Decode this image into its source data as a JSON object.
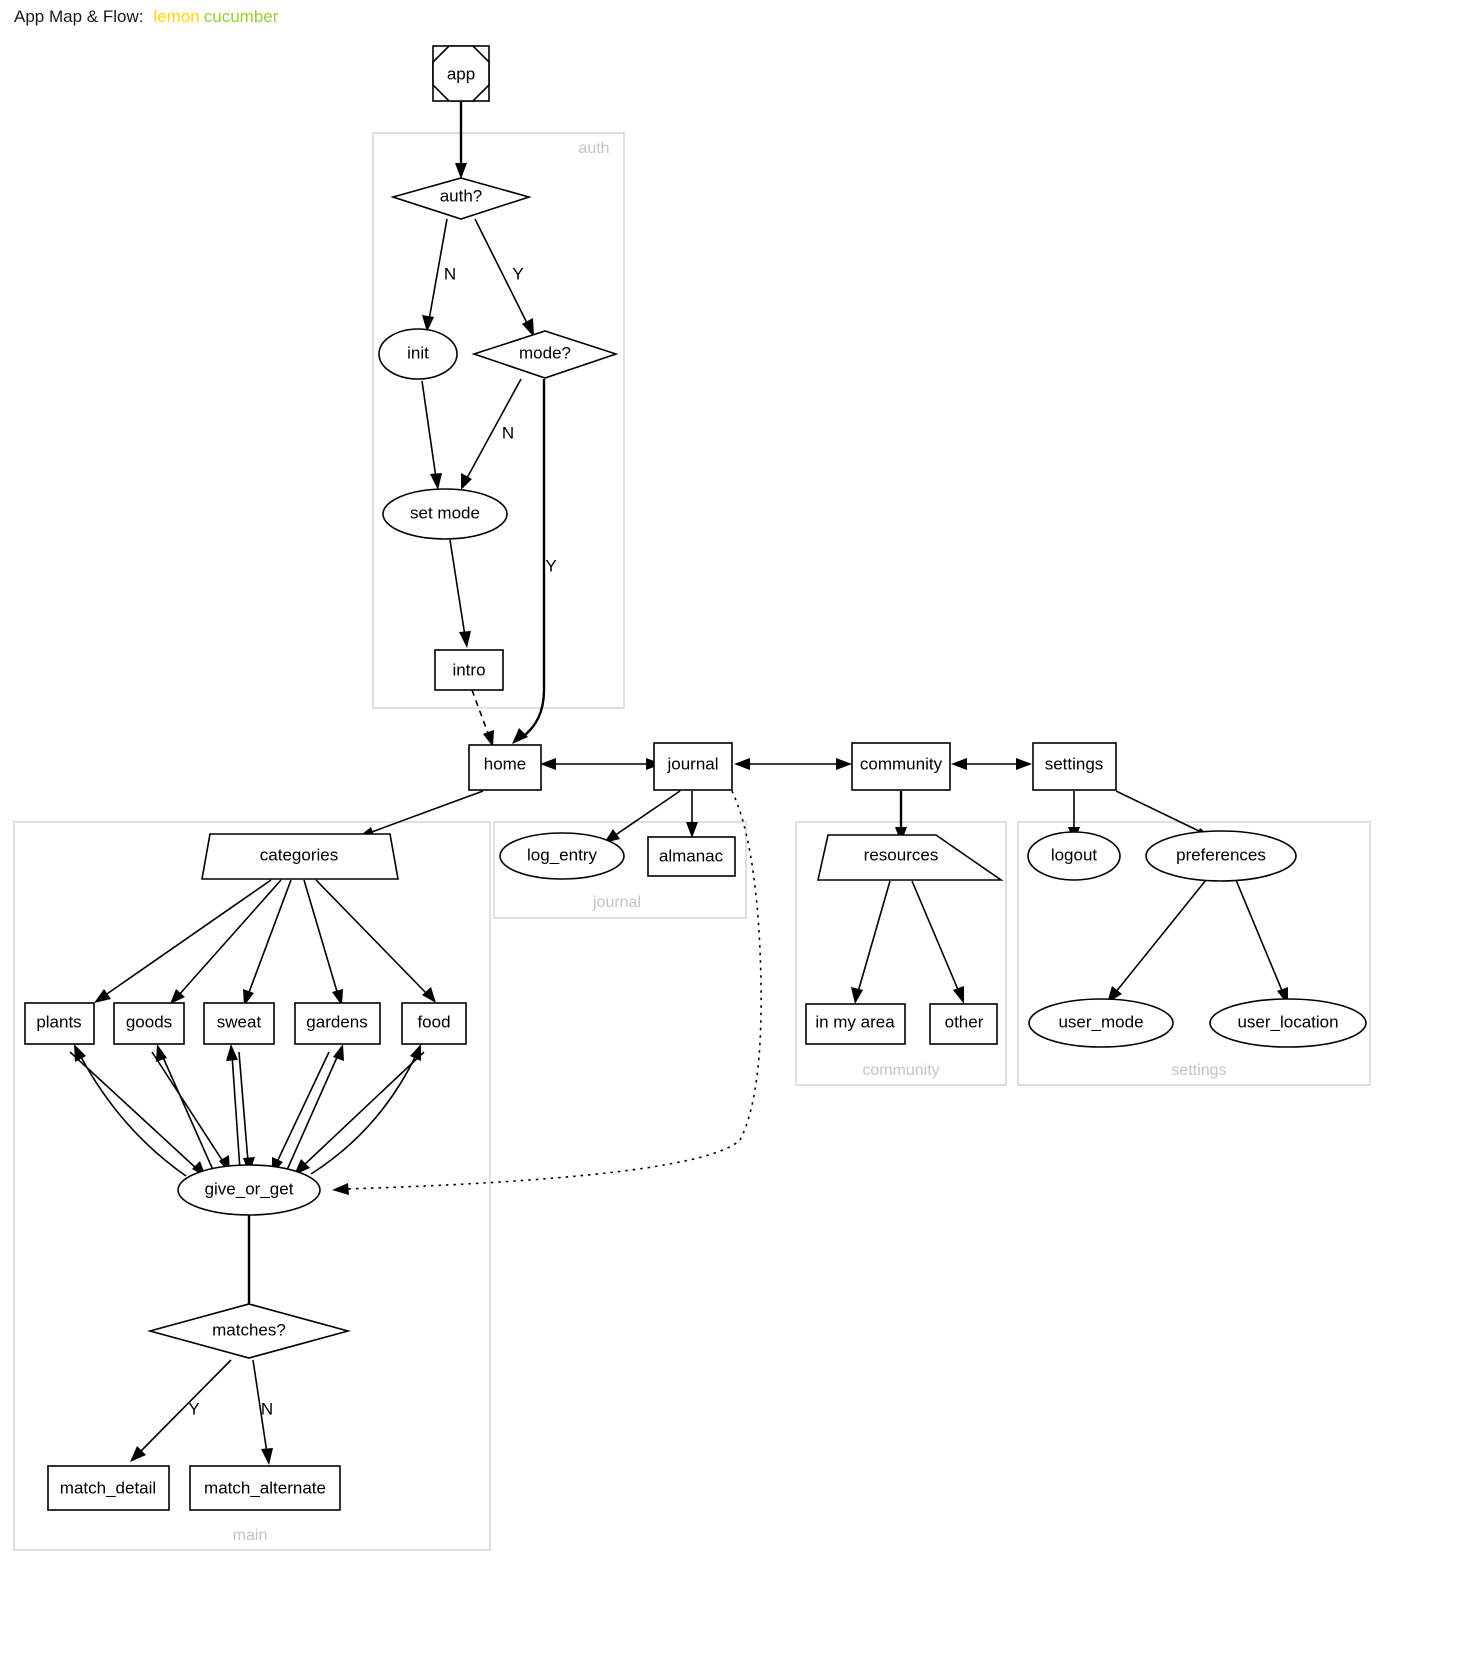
{
  "title": {
    "prefix": "App Map & Flow:",
    "word1": "lemon",
    "word2": "cucumber",
    "word1_color": "#ffd700",
    "word2_color": "#9acd32"
  },
  "clusters": [
    {
      "id": "auth",
      "label": "auth",
      "label_pos": "top-right"
    },
    {
      "id": "main",
      "label": "main",
      "label_pos": "bottom"
    },
    {
      "id": "journal",
      "label": "journal",
      "label_pos": "bottom"
    },
    {
      "id": "community",
      "label": "community",
      "label_pos": "bottom"
    },
    {
      "id": "settings",
      "label": "settings",
      "label_pos": "bottom"
    }
  ],
  "nodes": [
    {
      "id": "app",
      "label": "app",
      "shape": "doubleoctagon",
      "cluster": null
    },
    {
      "id": "auth_q",
      "label": "auth?",
      "shape": "diamond",
      "cluster": "auth"
    },
    {
      "id": "init",
      "label": "init",
      "shape": "ellipse",
      "cluster": "auth"
    },
    {
      "id": "mode_q",
      "label": "mode?",
      "shape": "diamond",
      "cluster": "auth"
    },
    {
      "id": "set_mode",
      "label": "set mode",
      "shape": "ellipse",
      "cluster": "auth"
    },
    {
      "id": "intro",
      "label": "intro",
      "shape": "box",
      "cluster": "auth"
    },
    {
      "id": "home",
      "label": "home",
      "shape": "box",
      "cluster": null
    },
    {
      "id": "journal",
      "label": "journal",
      "shape": "box",
      "cluster": null
    },
    {
      "id": "community",
      "label": "community",
      "shape": "box",
      "cluster": null
    },
    {
      "id": "settings",
      "label": "settings",
      "shape": "box",
      "cluster": null
    },
    {
      "id": "categories",
      "label": "categories",
      "shape": "invtrapezium",
      "cluster": "main"
    },
    {
      "id": "plants",
      "label": "plants",
      "shape": "box",
      "cluster": "main"
    },
    {
      "id": "goods",
      "label": "goods",
      "shape": "box",
      "cluster": "main"
    },
    {
      "id": "sweat",
      "label": "sweat",
      "shape": "box",
      "cluster": "main"
    },
    {
      "id": "gardens",
      "label": "gardens",
      "shape": "box",
      "cluster": "main"
    },
    {
      "id": "food",
      "label": "food",
      "shape": "box",
      "cluster": "main"
    },
    {
      "id": "give_or_get",
      "label": "give_or_get",
      "shape": "ellipse",
      "cluster": "main"
    },
    {
      "id": "matches_q",
      "label": "matches?",
      "shape": "diamond",
      "cluster": "main"
    },
    {
      "id": "match_detail",
      "label": "match_detail",
      "shape": "box",
      "cluster": "main"
    },
    {
      "id": "match_alternate",
      "label": "match_alternate",
      "shape": "box",
      "cluster": "main"
    },
    {
      "id": "log_entry",
      "label": "log_entry",
      "shape": "ellipse",
      "cluster": "journal"
    },
    {
      "id": "almanac",
      "label": "almanac",
      "shape": "box",
      "cluster": "journal"
    },
    {
      "id": "resources",
      "label": "resources",
      "shape": "invtrapezium",
      "cluster": "community"
    },
    {
      "id": "in_my_area",
      "label": "in my area",
      "shape": "box",
      "cluster": "community"
    },
    {
      "id": "other",
      "label": "other",
      "shape": "box",
      "cluster": "community"
    },
    {
      "id": "logout",
      "label": "logout",
      "shape": "ellipse",
      "cluster": "settings"
    },
    {
      "id": "preferences",
      "label": "preferences",
      "shape": "ellipse",
      "cluster": "settings"
    },
    {
      "id": "user_mode",
      "label": "user_mode",
      "shape": "ellipse",
      "cluster": "settings"
    },
    {
      "id": "user_location",
      "label": "user_location",
      "shape": "ellipse",
      "cluster": "settings"
    }
  ],
  "edges": [
    {
      "from": "app",
      "to": "auth_q",
      "label": "",
      "style": "solid"
    },
    {
      "from": "auth_q",
      "to": "init",
      "label": "N",
      "style": "solid"
    },
    {
      "from": "auth_q",
      "to": "mode_q",
      "label": "Y",
      "style": "solid"
    },
    {
      "from": "init",
      "to": "set_mode",
      "label": "",
      "style": "solid"
    },
    {
      "from": "mode_q",
      "to": "set_mode",
      "label": "N",
      "style": "solid"
    },
    {
      "from": "mode_q",
      "to": "home",
      "label": "Y",
      "style": "solid"
    },
    {
      "from": "set_mode",
      "to": "intro",
      "label": "",
      "style": "solid"
    },
    {
      "from": "intro",
      "to": "home",
      "label": "",
      "style": "dashed"
    },
    {
      "from": "home",
      "to": "journal",
      "label": "",
      "style": "bidirectional"
    },
    {
      "from": "journal",
      "to": "community",
      "label": "",
      "style": "bidirectional"
    },
    {
      "from": "community",
      "to": "settings",
      "label": "",
      "style": "bidirectional"
    },
    {
      "from": "home",
      "to": "categories",
      "label": "",
      "style": "solid"
    },
    {
      "from": "categories",
      "to": "plants",
      "label": "",
      "style": "solid"
    },
    {
      "from": "categories",
      "to": "goods",
      "label": "",
      "style": "solid"
    },
    {
      "from": "categories",
      "to": "sweat",
      "label": "",
      "style": "solid"
    },
    {
      "from": "categories",
      "to": "gardens",
      "label": "",
      "style": "solid"
    },
    {
      "from": "categories",
      "to": "food",
      "label": "",
      "style": "solid"
    },
    {
      "from": "plants",
      "to": "give_or_get",
      "label": "",
      "style": "solid"
    },
    {
      "from": "goods",
      "to": "give_or_get",
      "label": "",
      "style": "solid"
    },
    {
      "from": "sweat",
      "to": "give_or_get",
      "label": "",
      "style": "solid"
    },
    {
      "from": "gardens",
      "to": "give_or_get",
      "label": "",
      "style": "solid"
    },
    {
      "from": "food",
      "to": "give_or_get",
      "label": "",
      "style": "solid"
    },
    {
      "from": "give_or_get",
      "to": "plants",
      "label": "",
      "style": "solid"
    },
    {
      "from": "give_or_get",
      "to": "goods",
      "label": "",
      "style": "solid"
    },
    {
      "from": "give_or_get",
      "to": "sweat",
      "label": "",
      "style": "solid"
    },
    {
      "from": "give_or_get",
      "to": "gardens",
      "label": "",
      "style": "solid"
    },
    {
      "from": "give_or_get",
      "to": "food",
      "label": "",
      "style": "solid"
    },
    {
      "from": "give_or_get",
      "to": "matches_q",
      "label": "",
      "style": "solid"
    },
    {
      "from": "matches_q",
      "to": "match_detail",
      "label": "Y",
      "style": "solid"
    },
    {
      "from": "matches_q",
      "to": "match_alternate",
      "label": "N",
      "style": "solid"
    },
    {
      "from": "journal",
      "to": "log_entry",
      "label": "",
      "style": "solid"
    },
    {
      "from": "journal",
      "to": "almanac",
      "label": "",
      "style": "solid"
    },
    {
      "from": "journal",
      "to": "give_or_get",
      "label": "",
      "style": "dotted"
    },
    {
      "from": "community",
      "to": "resources",
      "label": "",
      "style": "solid"
    },
    {
      "from": "resources",
      "to": "in_my_area",
      "label": "",
      "style": "solid"
    },
    {
      "from": "resources",
      "to": "other",
      "label": "",
      "style": "solid"
    },
    {
      "from": "settings",
      "to": "logout",
      "label": "",
      "style": "solid"
    },
    {
      "from": "settings",
      "to": "preferences",
      "label": "",
      "style": "solid"
    },
    {
      "from": "preferences",
      "to": "user_mode",
      "label": "",
      "style": "solid"
    },
    {
      "from": "preferences",
      "to": "user_location",
      "label": "",
      "style": "solid"
    }
  ],
  "labels": {
    "app": "app",
    "auth_q": "auth?",
    "init": "init",
    "mode_q": "mode?",
    "set_mode": "set mode",
    "intro": "intro",
    "home": "home",
    "journal": "journal",
    "community": "community",
    "settings": "settings",
    "categories": "categories",
    "plants": "plants",
    "goods": "goods",
    "sweat": "sweat",
    "gardens": "gardens",
    "food": "food",
    "give_or_get": "give_or_get",
    "matches_q": "matches?",
    "match_detail": "match_detail",
    "match_alternate": "match_alternate",
    "log_entry": "log_entry",
    "almanac": "almanac",
    "resources": "resources",
    "in_my_area": "in my area",
    "other": "other",
    "logout": "logout",
    "preferences": "preferences",
    "user_mode": "user_mode",
    "user_location": "user_location",
    "cluster_auth": "auth",
    "cluster_main": "main",
    "cluster_journal": "journal",
    "cluster_community": "community",
    "cluster_settings": "settings",
    "edge_auth_n": "N",
    "edge_auth_y": "Y",
    "edge_mode_n": "N",
    "edge_mode_y": "Y",
    "edge_matches_y": "Y",
    "edge_matches_n": "N"
  }
}
